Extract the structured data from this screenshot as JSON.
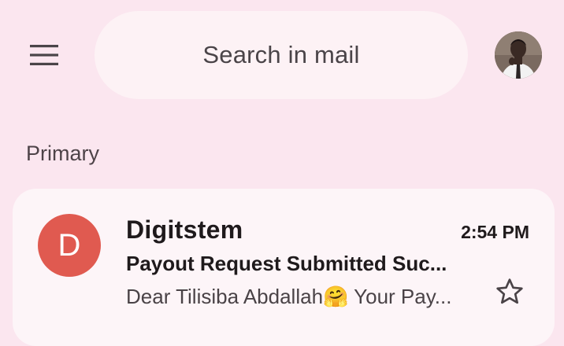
{
  "header": {
    "menu_icon": "hamburger-menu-icon",
    "search_placeholder": "Search in mail",
    "account_avatar": "account-avatar-photo"
  },
  "section": {
    "label": "Primary"
  },
  "emails": [
    {
      "avatar_letter": "D",
      "avatar_color": "#e05a50",
      "sender": "Digitstem",
      "time": "2:54 PM",
      "subject": "Payout Request Submitted Suc...",
      "snippet": "Dear Tilisiba Abdallah🤗 Your Pay...",
      "starred": false,
      "star_icon": "star-outline-icon"
    }
  ],
  "colors": {
    "background": "#fbe6ef",
    "search_bg": "#fdf2f5",
    "card_bg": "#fdf5f8"
  }
}
